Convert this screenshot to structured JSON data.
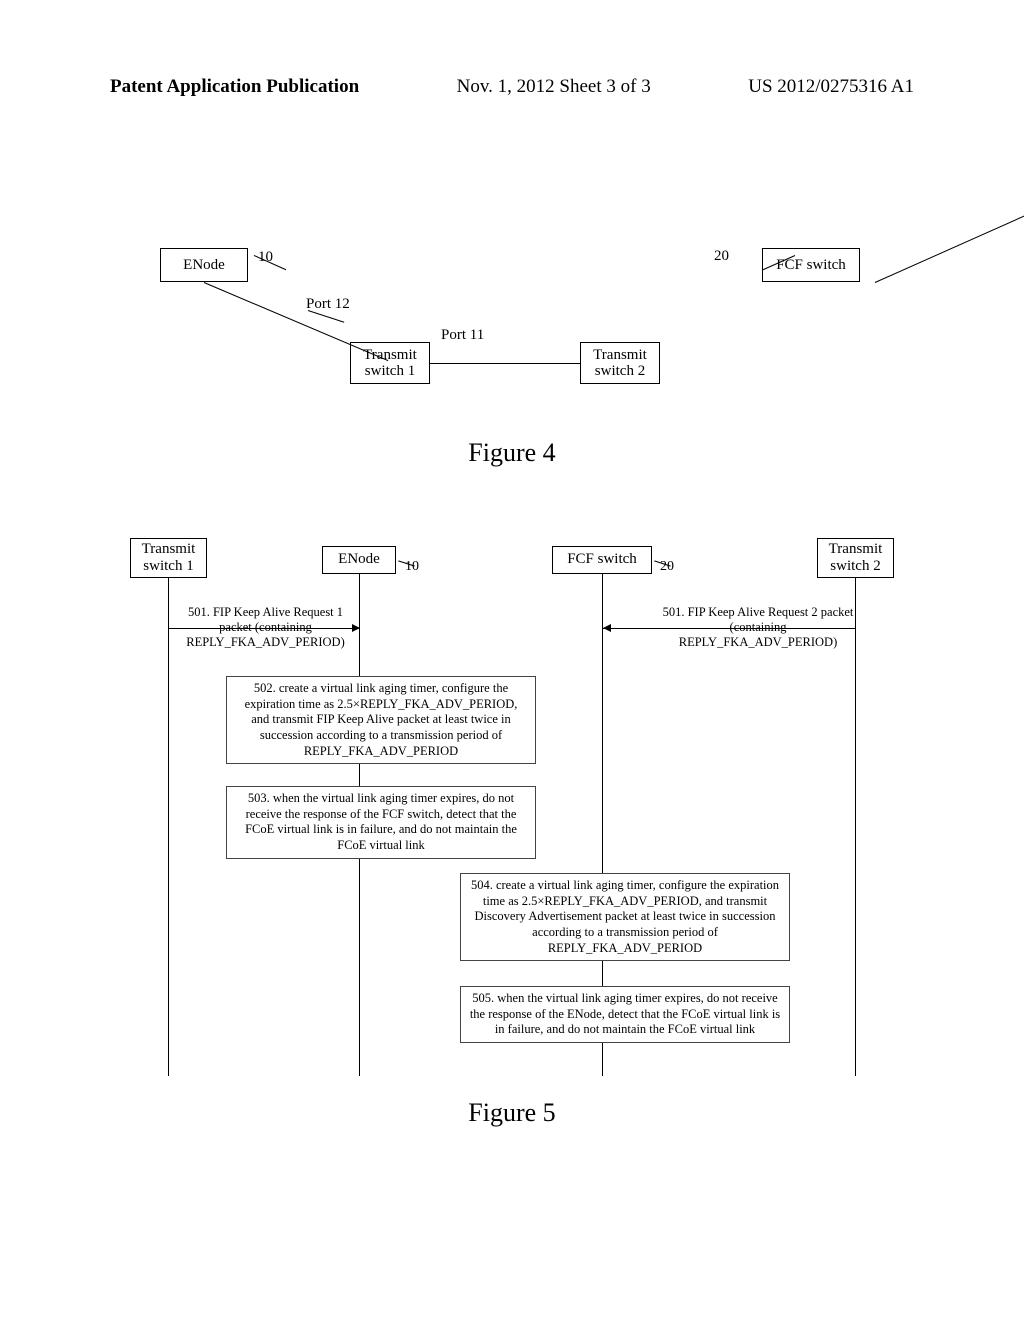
{
  "header": {
    "left": "Patent Application Publication",
    "mid": "Nov. 1, 2012  Sheet 3 of 3",
    "right": "US 2012/0275316 A1"
  },
  "fig4": {
    "caption": "Figure 4",
    "enode": "ENode",
    "fcf": "FCF switch",
    "ts1": "Transmit switch 1",
    "ts2": "Transmit switch 2",
    "tag10": "10",
    "tag20": "20",
    "port11": "Port 11",
    "port12": "Port 12"
  },
  "fig5": {
    "caption": "Figure 5",
    "ts1": "Transmit switch 1",
    "enode": "ENode",
    "fcf": "FCF switch",
    "ts2": "Transmit switch 2",
    "tag10": "10",
    "tag20": "20",
    "msg501a": "501. FIP Keep Alive Request 1 packet (containing REPLY_FKA_ADV_PERIOD)",
    "msg501b": "501. FIP Keep Alive Request 2 packet (containing REPLY_FKA_ADV_PERIOD)",
    "op502": "502. create a virtual link aging timer, configure the expiration time as 2.5×REPLY_FKA_ADV_PERIOD, and transmit FIP Keep Alive packet at least twice in succession according to a transmission period of REPLY_FKA_ADV_PERIOD",
    "op503": "503. when the virtual link aging timer expires, do not receive the response of the FCF switch, detect that the FCoE virtual link is in failure, and do not maintain the FCoE virtual link",
    "op504": "504. create a virtual link aging timer, configure the expiration time as 2.5×REPLY_FKA_ADV_PERIOD, and transmit Discovery Advertisement packet at least twice in succession according to a transmission period of REPLY_FKA_ADV_PERIOD",
    "op505": "505. when the virtual link aging timer expires, do not receive the response of the ENode, detect that the FCoE virtual link is in failure, and do not maintain the FCoE virtual link"
  }
}
